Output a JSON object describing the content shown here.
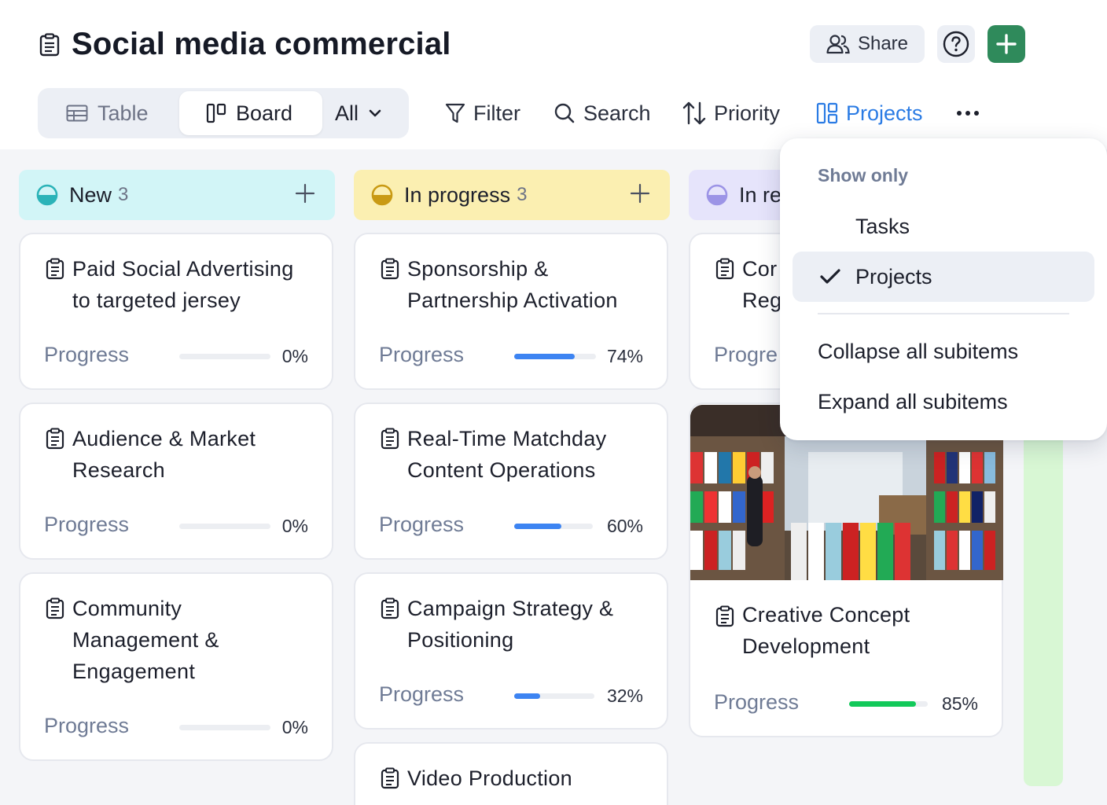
{
  "header": {
    "title": "Social media commercial",
    "share_label": "Share",
    "help_icon": "help-circle-icon",
    "add_icon": "plus-icon"
  },
  "toolbar": {
    "views": [
      {
        "label": "Table",
        "icon": "table-icon"
      },
      {
        "label": "Board",
        "icon": "board-icon",
        "active": true
      }
    ],
    "filter_scope": "All",
    "tools": [
      {
        "label": "Filter",
        "icon": "filter-icon"
      },
      {
        "label": "Search",
        "icon": "search-icon"
      },
      {
        "label": "Priority",
        "icon": "sort-icon"
      },
      {
        "label": "Projects",
        "icon": "projects-icon",
        "active": true
      }
    ]
  },
  "columns": [
    {
      "name": "New",
      "count": "3",
      "color": "#d2f5f7",
      "status_color": "#2bb3b8",
      "cards": [
        {
          "title": "Paid Social Advertising to targeted jersey",
          "progress_label": "Progress",
          "progress": 0,
          "pct": "0%"
        },
        {
          "title": "Audience & Market Research",
          "progress_label": "Progress",
          "progress": 0,
          "pct": "0%"
        },
        {
          "title": "Community Management & Engagement",
          "progress_label": "Progress",
          "progress": 0,
          "pct": "0%"
        }
      ]
    },
    {
      "name": "In progress",
      "count": "3",
      "color": "#fbefb1",
      "status_color": "#c99a14",
      "cards": [
        {
          "title": "Sponsorship & Partnership Activation",
          "progress_label": "Progress",
          "progress": 74,
          "pct": "74%"
        },
        {
          "title": "Real-Time Matchday Content Operations",
          "progress_label": "Progress",
          "progress": 60,
          "pct": "60%"
        },
        {
          "title": "Campaign Strategy & Positioning",
          "progress_label": "Progress",
          "progress": 32,
          "pct": "32%"
        },
        {
          "title": "Video Production"
        }
      ]
    },
    {
      "name": "In re",
      "color": "#e6e4fb",
      "status_color": "#9c94e6",
      "cards": [
        {
          "title_line1": "Cor",
          "title_line2": "Reg",
          "progress_label": "Progre"
        },
        {
          "title": "Creative Concept Development",
          "progress_label": "Progress",
          "progress": 85,
          "pct": "85%"
        }
      ]
    }
  ],
  "colors": {
    "accent": "#2a7be4",
    "bar_blue": "#3d84f2",
    "bar_green": "#12c95a",
    "add_button": "#2f8a5b"
  },
  "menu": {
    "header": "Show only",
    "options": [
      {
        "label": "Tasks",
        "selected": false
      },
      {
        "label": "Projects",
        "selected": true
      }
    ],
    "actions": [
      "Collapse all subitems",
      "Expand all subitems"
    ]
  }
}
